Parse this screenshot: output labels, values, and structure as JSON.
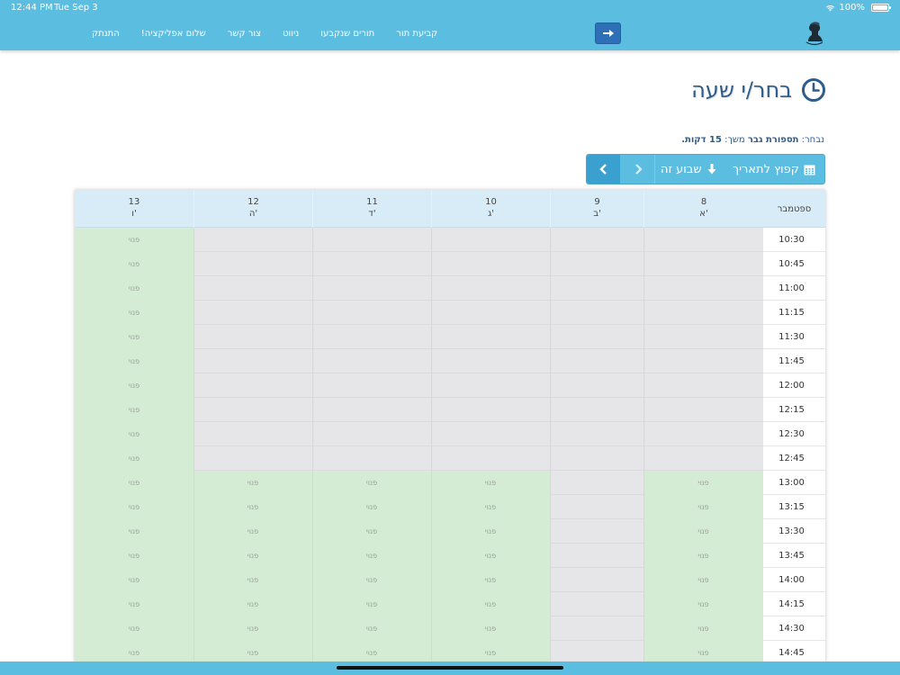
{
  "status_bar": {
    "time": "12:44 PM",
    "date": "Tue Sep 3",
    "battery": "100%"
  },
  "nav": {
    "links": [
      "קביעת תור",
      "תורים שנקבעו",
      "ניווט",
      "צור קשר",
      "שלום אפליקציה!",
      "התנתק"
    ]
  },
  "page": {
    "title": "בחר/י שעה",
    "selection_label": "נבחר:",
    "selection_service": "תספורת גבר",
    "duration_label": "משך:",
    "duration_value": "15 דקות."
  },
  "toolbar": {
    "this_week": "שבוע זה",
    "jump_to_date": "קפוץ לתאריך"
  },
  "calendar": {
    "month": "ספטמבר",
    "days": [
      {
        "num": "8",
        "name": "א'"
      },
      {
        "num": "9",
        "name": "ב'"
      },
      {
        "num": "10",
        "name": "ג'"
      },
      {
        "num": "11",
        "name": "ד'"
      },
      {
        "num": "12",
        "name": "ה'"
      },
      {
        "num": "13",
        "name": "ו'"
      }
    ],
    "times": [
      "10:30",
      "10:45",
      "11:00",
      "11:15",
      "11:30",
      "11:45",
      "12:00",
      "12:15",
      "12:30",
      "12:45",
      "13:00",
      "13:15",
      "13:30",
      "13:45",
      "14:00",
      "14:15",
      "14:30",
      "14:45"
    ],
    "free_label": "פנוי",
    "availability": [
      [
        0,
        0,
        0,
        0,
        0,
        1
      ],
      [
        0,
        0,
        0,
        0,
        0,
        1
      ],
      [
        0,
        0,
        0,
        0,
        0,
        1
      ],
      [
        0,
        0,
        0,
        0,
        0,
        1
      ],
      [
        0,
        0,
        0,
        0,
        0,
        1
      ],
      [
        0,
        0,
        0,
        0,
        0,
        1
      ],
      [
        0,
        0,
        0,
        0,
        0,
        1
      ],
      [
        0,
        0,
        0,
        0,
        0,
        1
      ],
      [
        0,
        0,
        0,
        0,
        0,
        1
      ],
      [
        0,
        0,
        0,
        0,
        0,
        1
      ],
      [
        1,
        0,
        1,
        1,
        1,
        1
      ],
      [
        1,
        0,
        1,
        1,
        1,
        1
      ],
      [
        1,
        0,
        1,
        1,
        1,
        1
      ],
      [
        1,
        0,
        1,
        1,
        1,
        1
      ],
      [
        1,
        0,
        1,
        1,
        1,
        1
      ],
      [
        1,
        0,
        1,
        1,
        1,
        1
      ],
      [
        1,
        0,
        1,
        1,
        1,
        1
      ],
      [
        1,
        0,
        1,
        1,
        1,
        1
      ]
    ]
  },
  "colors": {
    "accent": "#5bbde0",
    "primary": "#2e6fb8",
    "free": "#d4ecd3",
    "busy": "#e6e6e9",
    "title": "#2d5d8c"
  }
}
